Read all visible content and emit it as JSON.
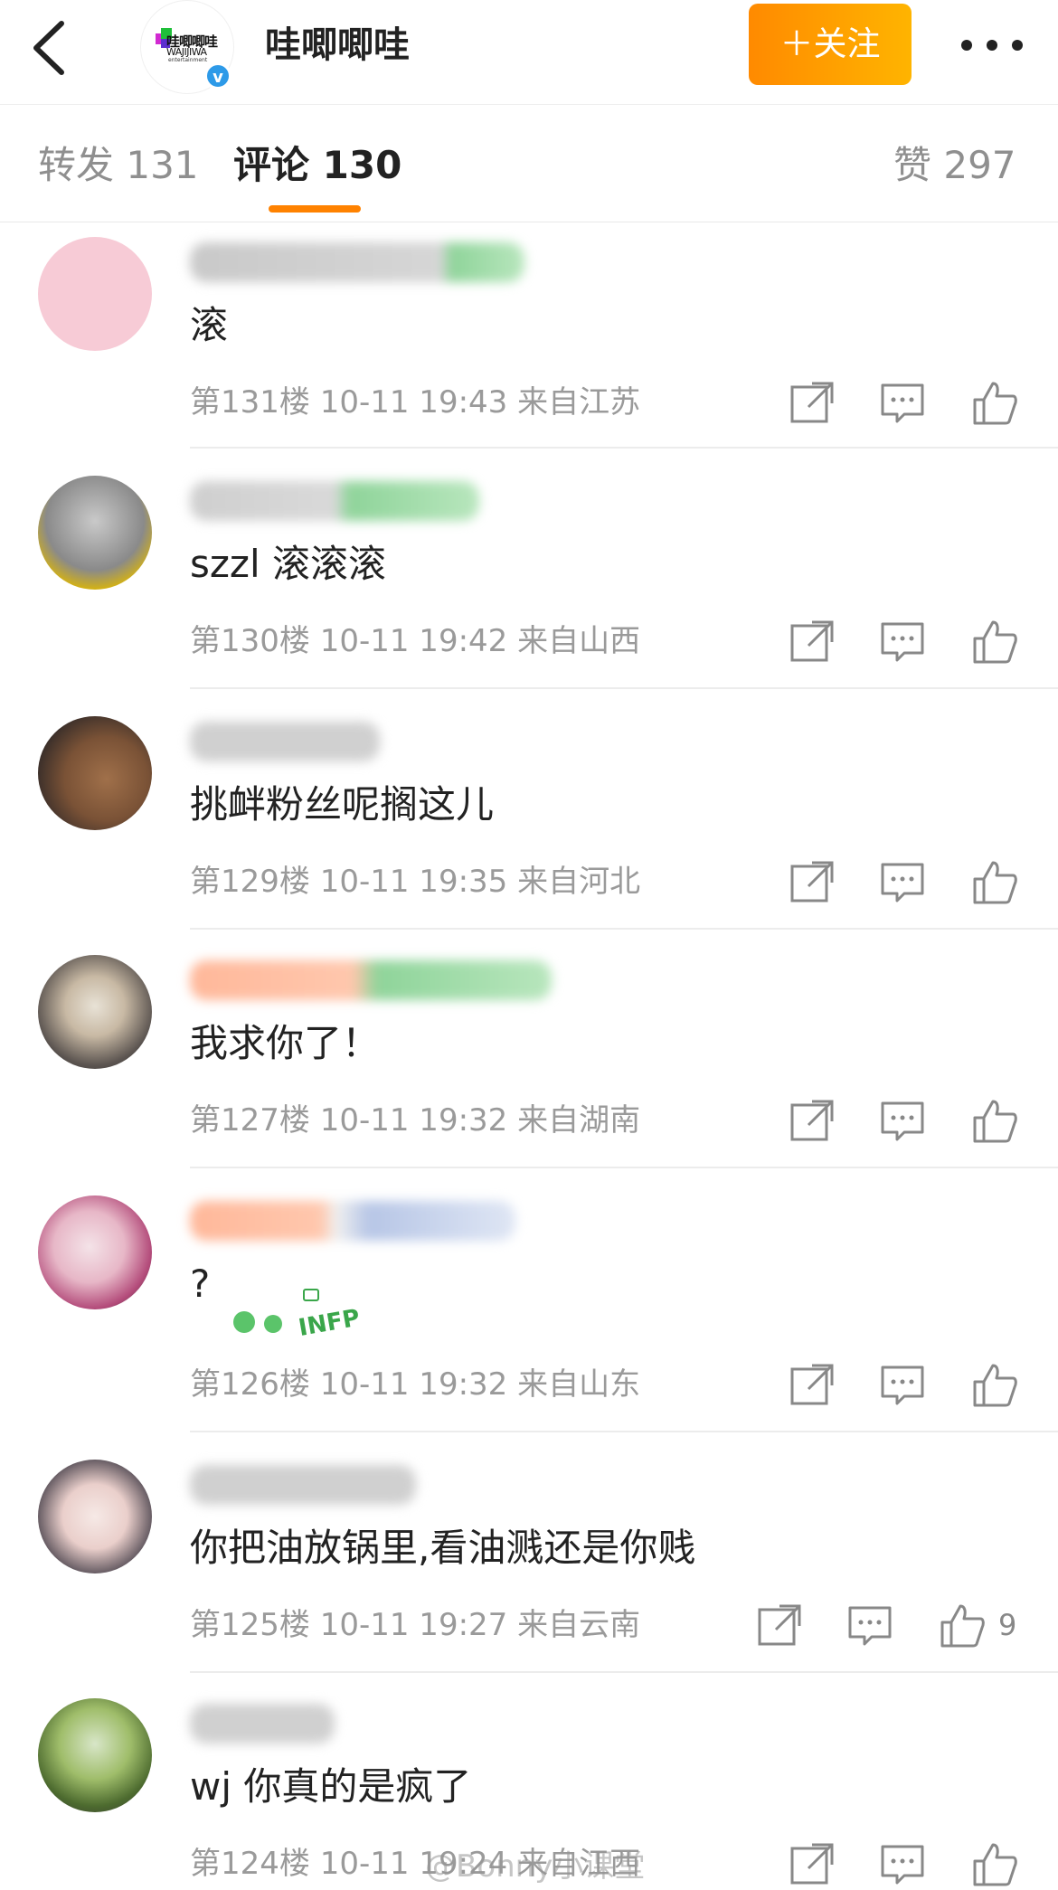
{
  "header": {
    "account_name": "哇唧唧哇",
    "logo_text": "哇唧唧哇",
    "logo_sub": "WAJIJIWA",
    "logo_sub2": "entertainment",
    "follow_label": "＋关注"
  },
  "tabs": {
    "repost": "转发 131",
    "comments": "评论 130",
    "likes": "赞 297"
  },
  "comments": [
    {
      "text": "滚",
      "meta": "第131楼 10-11 19:43  来自江苏",
      "likes": ""
    },
    {
      "text": "szzl 滚滚滚",
      "meta": "第130楼 10-11 19:42  来自山西",
      "likes": ""
    },
    {
      "text": "挑衅粉丝呢搁这儿",
      "meta": "第129楼 10-11 19:35  来自河北",
      "likes": ""
    },
    {
      "text": "我求你了！",
      "meta": "第127楼 10-11 19:32  来自湖南",
      "likes": ""
    },
    {
      "text": "?",
      "meta": "第126楼 10-11 19:32  来自山东",
      "likes": "",
      "sticker_text": "INFP"
    },
    {
      "text": "你把油放锅里,看油溅还是你贱",
      "meta": "第125楼 10-11 19:27  来自云南",
      "likes": "9"
    },
    {
      "text": "wj 你真的是疯了",
      "meta": "第124楼 10-11 19:24  来自江西",
      "likes": ""
    }
  ],
  "watermark": "@Bonny小课堂",
  "colors": {
    "accent": "#ff8200",
    "follow_gradient_start": "#ff8a00",
    "follow_gradient_end": "#ffb400",
    "verified_blue": "#2d9ae8"
  }
}
